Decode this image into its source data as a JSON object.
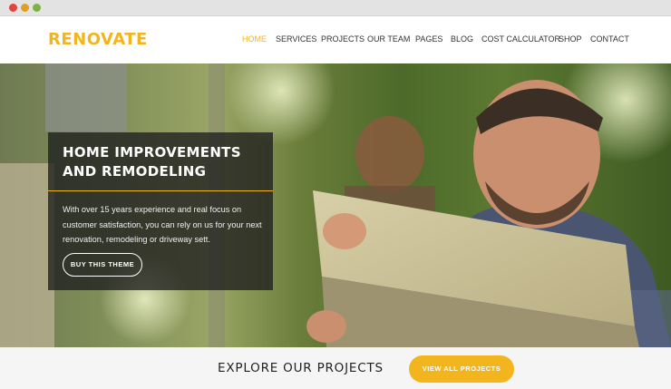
{
  "brand": {
    "logo": "RENOVATE",
    "accent_color": "#f2b51d"
  },
  "nav": {
    "items": [
      {
        "label": "HOME",
        "active": true
      },
      {
        "label": "SERVICES",
        "active": false
      },
      {
        "label": "PROJECTS",
        "active": false
      },
      {
        "label": "OUR TEAM",
        "active": false
      },
      {
        "label": "PAGES",
        "active": false
      },
      {
        "label": "BLOG",
        "active": false
      },
      {
        "label": "COST CALCULATOR",
        "active": false
      },
      {
        "label": "SHOP",
        "active": false
      },
      {
        "label": "CONTACT",
        "active": false
      }
    ]
  },
  "hero": {
    "title": "HOME IMPROVEMENTS AND REMODELING",
    "text": "With over 15 years experience and real focus on customer satisfaction, you can rely on us for your next renovation, remodeling or driveway sett.",
    "button_label": "BUY THIS THEME"
  },
  "bottom": {
    "heading": "EXPLORE OUR PROJECTS",
    "button_label": "VIEW ALL PROJECTS"
  }
}
